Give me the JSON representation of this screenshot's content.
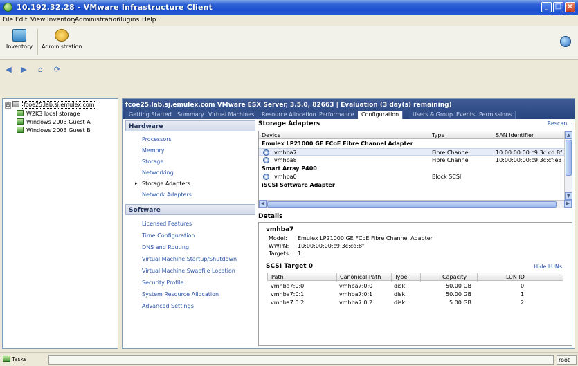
{
  "window": {
    "title": "10.192.32.28 - VMware Infrastructure Client",
    "buttons": {
      "minimize": "_",
      "maximize": "□",
      "close": "×"
    }
  },
  "menu": [
    "File",
    "Edit",
    "View",
    "Inventory",
    "Administration",
    "Plugins",
    "Help"
  ],
  "toolbar": {
    "inventory": "Inventory",
    "administration": "Administration"
  },
  "tree": {
    "host": "fcoe25.lab.sj.emulex.com",
    "vms": [
      "W2K3 local storage",
      "Windows 2003 Guest A",
      "Windows 2003 Guest B"
    ],
    "expander": "⊟"
  },
  "host_header": {
    "title": "fcoe25.lab.sj.emulex.com VMware ESX Server, 3.5.0, 82663 | Evaluation (3 day(s) remaining)"
  },
  "tabs": [
    "Getting Started",
    "Summary",
    "Virtual Machines",
    "Resource Allocation",
    "Performance",
    "Configuration",
    "Users & Groups",
    "Events",
    "Permissions"
  ],
  "active_tab": "Configuration",
  "hardware": {
    "heading": "Hardware",
    "items": [
      "Processors",
      "Memory",
      "Storage",
      "Networking",
      "Storage Adapters",
      "Network Adapters"
    ],
    "selected": "Storage Adapters",
    "bullet": "▸"
  },
  "software": {
    "heading": "Software",
    "items": [
      "Licensed Features",
      "Time Configuration",
      "DNS and Routing",
      "Virtual Machine Startup/Shutdown",
      "Virtual Machine Swapfile Location",
      "Security Profile",
      "System Resource Allocation",
      "Advanced Settings"
    ]
  },
  "storage_adapters": {
    "title": "Storage Adapters",
    "rescan": "Rescan...",
    "columns": [
      "Device",
      "Type",
      "SAN Identifier"
    ],
    "groups": [
      {
        "name": "Emulex LP21000 GE FCoE Fibre Channel Adapter",
        "rows": [
          {
            "device": "vmhba7",
            "type": "Fibre Channel",
            "san": "10:00:00:00:c9:3c:cd:8f"
          },
          {
            "device": "vmhba8",
            "type": "Fibre Channel",
            "san": "10:00:00:00:c9:3c:cf:e3"
          }
        ]
      },
      {
        "name": "Smart Array P400",
        "rows": [
          {
            "device": "vmhba0",
            "type": "Block SCSI",
            "san": ""
          }
        ]
      },
      {
        "name": "iSCSI Software Adapter",
        "rows": []
      }
    ]
  },
  "details": {
    "title": "Details",
    "device": "vmhba7",
    "model_label": "Model:",
    "model": "Emulex LP21000 GE FCoE Fibre Channel Adapter",
    "wwpn_label": "WWPN:",
    "wwpn": "10:00:00:00:c9:3c:cd:8f",
    "targets_label": "Targets:",
    "targets": "1",
    "scsi_target": "SCSI Target 0",
    "hide_luns": "Hide LUNs",
    "lun_columns": [
      "Path",
      "Canonical Path",
      "Type",
      "Capacity",
      "LUN ID"
    ],
    "luns": [
      {
        "path": "vmhba7:0:0",
        "canonical": "vmhba7:0:0",
        "type": "disk",
        "capacity": "50.00 GB",
        "lun": "0"
      },
      {
        "path": "vmhba7:0:1",
        "canonical": "vmhba7:0:1",
        "type": "disk",
        "capacity": "50.00 GB",
        "lun": "1"
      },
      {
        "path": "vmhba7:0:2",
        "canonical": "vmhba7:0:2",
        "type": "disk",
        "capacity": "5.00 GB",
        "lun": "2"
      }
    ]
  },
  "statusbar": {
    "tasks": "Tasks",
    "user": "root"
  },
  "nav": {
    "back": "◀",
    "forward": "▶",
    "home": "⌂",
    "refresh": "⟳"
  },
  "scroll": {
    "up": "▲",
    "down": "▼",
    "left": "◀",
    "right": "▶"
  }
}
